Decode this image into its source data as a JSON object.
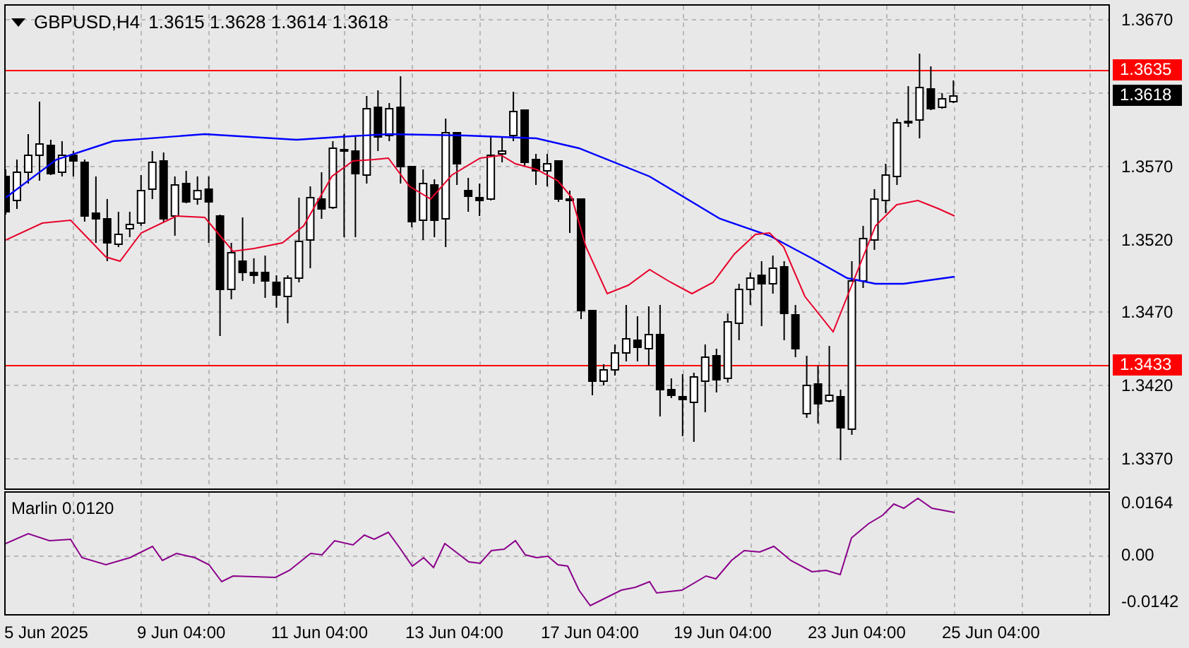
{
  "price_chart": {
    "symbol": "GBPUSD,H4",
    "quote": "1.3615 1.3628 1.3614 1.3618",
    "price_levels": [
      {
        "label": "1.3635"
      },
      {
        "label": "1.3433"
      }
    ],
    "last_price": "1.3618",
    "y_ticks": [
      "1.3670",
      "1.3570",
      "1.3520",
      "1.3470",
      "1.3420",
      "1.3370"
    ]
  },
  "indicator": {
    "label": "Marlin 0.0120",
    "y_ticks": [
      "0.0164",
      "0.00",
      "-0.0142"
    ]
  },
  "time_axis": [
    "5 Jun 2025",
    "9 Jun 04:00",
    "11 Jun 04:00",
    "13 Jun 04:00",
    "17 Jun 04:00",
    "19 Jun 04:00",
    "23 Jun 04:00",
    "25 Jun 04:00"
  ]
}
